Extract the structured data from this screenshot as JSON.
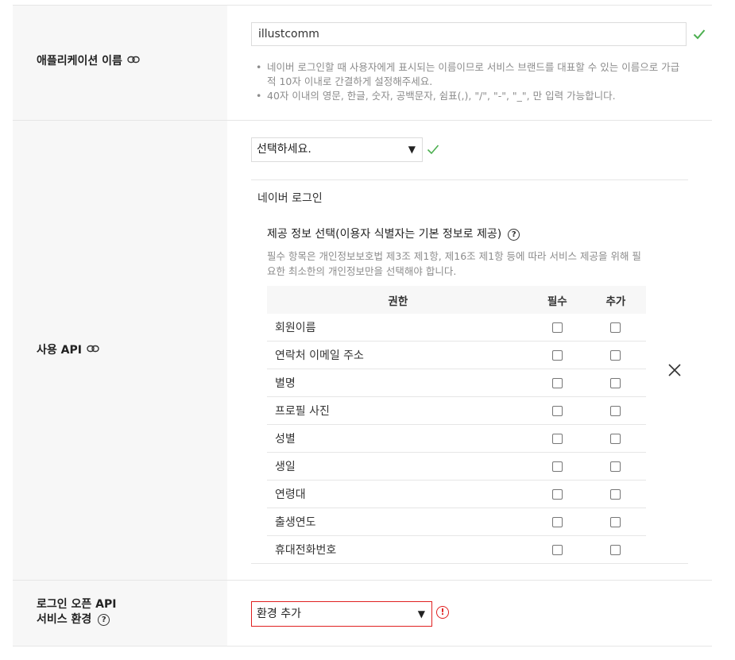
{
  "app_name": {
    "label": "애플리케이션 이름",
    "value": "illustcomm",
    "notes": [
      "네이버 로그인할 때 사용자에게 표시되는 이름이므로 서비스 브랜드를 대표할 수 있는 이름으로 가급적 10자 이내로 간결하게 설정해주세요.",
      "40자 이내의 영문, 한글, 숫자, 공백문자, 쉼표(,), \"/\", \"-\", \"_\", 만 입력 가능합니다."
    ]
  },
  "api": {
    "label": "사용 API",
    "select_value": "선택하세요.",
    "section_title": "네이버 로그인",
    "provide_title": "제공 정보 선택(이용자 식별자는 기본 정보로 제공)",
    "provide_desc": "필수 항목은 개인정보보호법 제3조 제1항, 제16조 제1항 등에 따라 서비스 제공을 위해 필요한 최소한의 개인정보만을 선택해야 합니다.",
    "table_headers": [
      "권한",
      "필수",
      "추가"
    ],
    "permissions": [
      "회원이름",
      "연락처 이메일 주소",
      "별명",
      "프로필 사진",
      "성별",
      "생일",
      "연령대",
      "출생연도",
      "휴대전화번호"
    ]
  },
  "env": {
    "label_line1": "로그인 오픈 API",
    "label_line2": "서비스 환경",
    "select_value": "환경 추가"
  },
  "icons": {
    "link": "link-icon",
    "help": "question-circle-icon",
    "check": "checkmark-icon",
    "close": "close-icon",
    "error": "exclamation-circle-icon",
    "dropdown": "triangle-down-icon"
  },
  "colors": {
    "success": "#4caf50",
    "error": "#e02020",
    "label_bg": "#f7f7f7"
  }
}
